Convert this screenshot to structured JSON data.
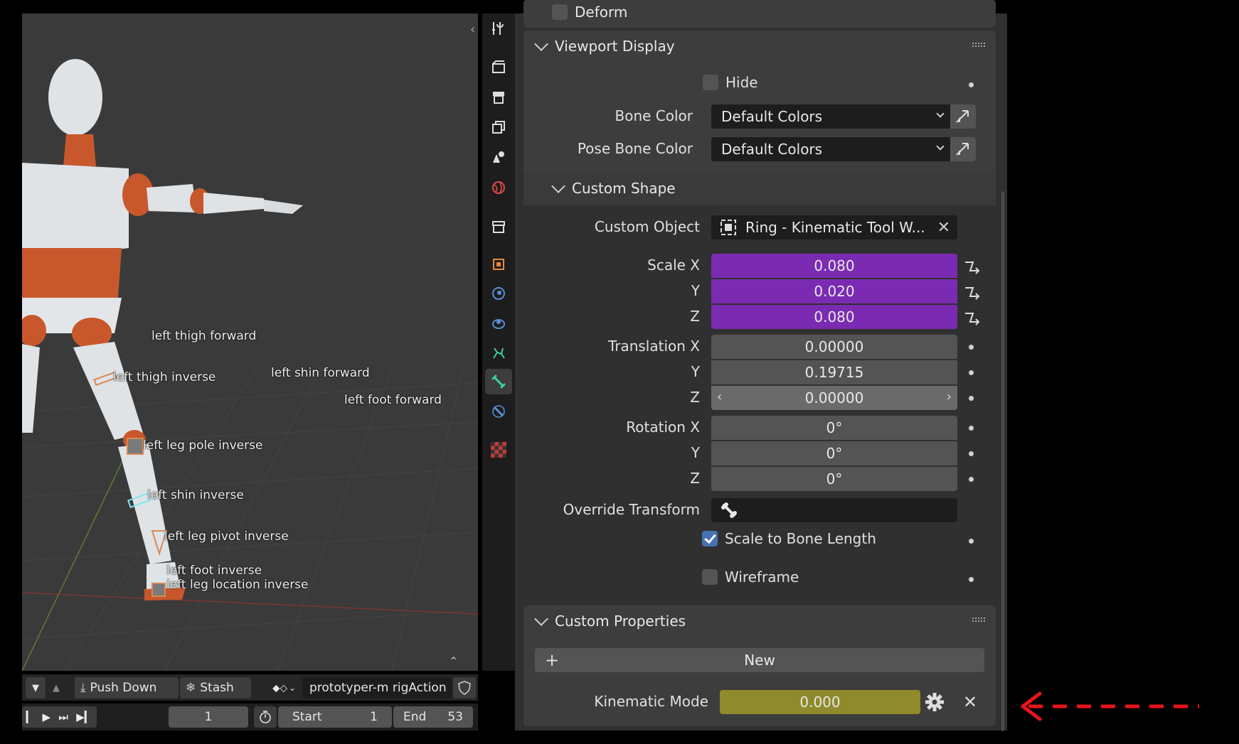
{
  "viewport": {
    "bone_labels": [
      {
        "text": "left thigh forward"
      },
      {
        "text": "left thigh inverse"
      },
      {
        "text": "left shin forward"
      },
      {
        "text": "left foot forward"
      },
      {
        "text": "left leg pole inverse"
      },
      {
        "text": "left shin inverse"
      },
      {
        "text": "left leg pivot inverse"
      },
      {
        "text": "left foot inverse"
      },
      {
        "text": "left leg location inverse"
      }
    ]
  },
  "nla": {
    "push_down": "Push Down",
    "stash": "Stash",
    "action_name": "prototyper-m rigAction"
  },
  "timeline": {
    "current_frame": "1",
    "start_label": "Start",
    "start_value": "1",
    "end_label": "End",
    "end_value": "53"
  },
  "props": {
    "deform_label": "Deform",
    "viewport_display": {
      "title": "Viewport Display",
      "hide_label": "Hide",
      "bone_color_label": "Bone Color",
      "bone_color_value": "Default Colors",
      "pose_bone_color_label": "Pose Bone Color",
      "pose_bone_color_value": "Default Colors"
    },
    "custom_shape": {
      "title": "Custom Shape",
      "custom_object_label": "Custom Object",
      "custom_object_value": "Ring - Kinematic Tool W...",
      "scale_x_label": "Scale X",
      "scale_x": "0.080",
      "scale_y_label": "Y",
      "scale_y": "0.020",
      "scale_z_label": "Z",
      "scale_z": "0.080",
      "trans_x_label": "Translation X",
      "trans_x": "0.00000",
      "trans_y_label": "Y",
      "trans_y": "0.19715",
      "trans_z_label": "Z",
      "trans_z": "0.00000",
      "rot_x_label": "Rotation X",
      "rot_x": "0°",
      "rot_y_label": "Y",
      "rot_y": "0°",
      "rot_z_label": "Z",
      "rot_z": "0°",
      "override_label": "Override Transform",
      "scale_bone_label": "Scale to Bone Length",
      "wireframe_label": "Wireframe"
    },
    "custom_properties": {
      "title": "Custom Properties",
      "new_label": "New",
      "kinematic_label": "Kinematic Mode",
      "kinematic_value": "0.000"
    }
  },
  "colors": {
    "purple_field": "#7b2bb2",
    "yellow_field": "#8f8a2c",
    "annotation_arrow": "#e8141c",
    "active_tab": "#3ecfa8"
  },
  "icons": [
    "tool-icon",
    "render-icon",
    "output-icon",
    "view-layer-icon",
    "scene-icon",
    "world-icon",
    "collection-icon",
    "object-icon",
    "modifier-icon",
    "particles-icon",
    "physics-icon",
    "object-data-icon",
    "bone-icon",
    "bone-constraint-icon",
    "texture-icon",
    "gear-icon",
    "close-icon",
    "bone-override-icon"
  ]
}
